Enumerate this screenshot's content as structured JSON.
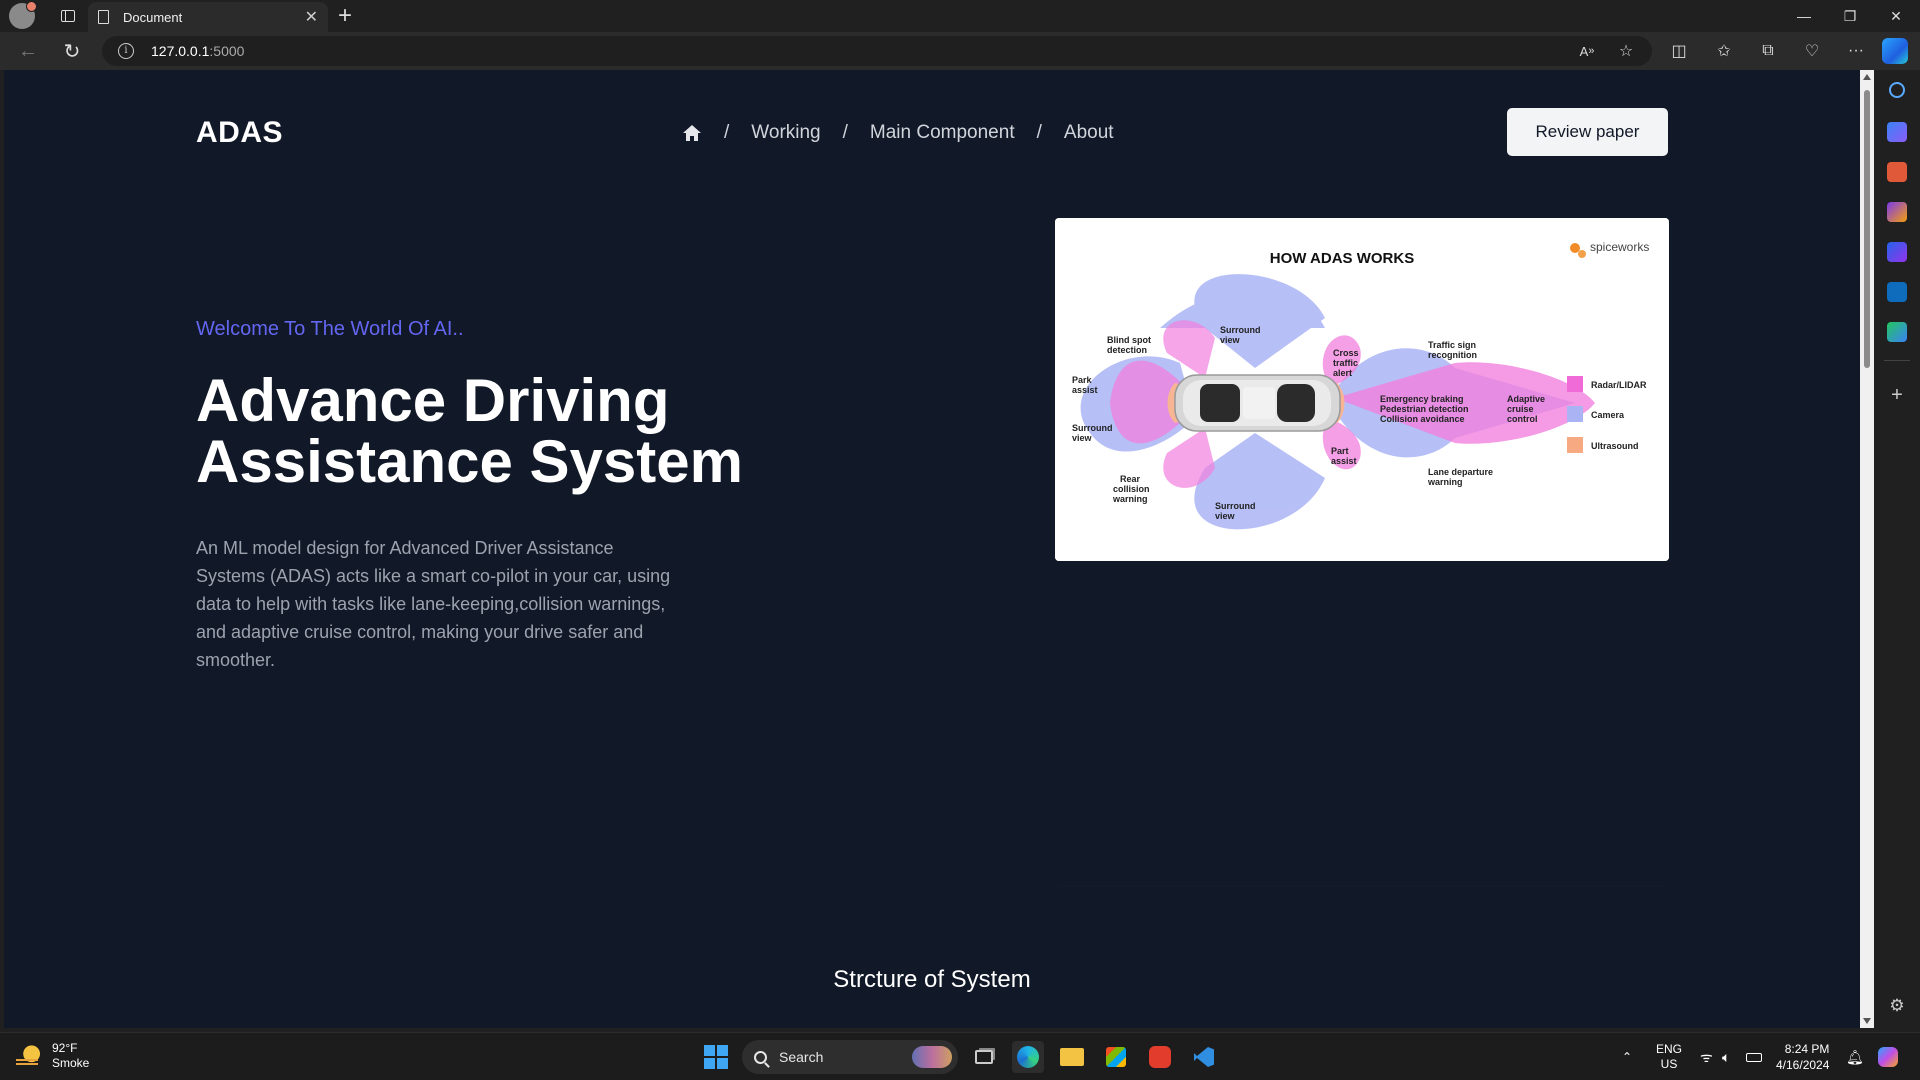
{
  "browser": {
    "tab_title": "Document",
    "url_host": "127.0.0.1",
    "url_port": ":5000"
  },
  "page": {
    "logo": "ADAS",
    "nav": [
      "Working",
      "Main Component",
      "About"
    ],
    "nav_sep": "/",
    "review_button": "Review paper",
    "welcome": "Welcome To The World Of AI..",
    "headline": "Advance Driving Assistance System",
    "description": "An ML model design for Advanced Driver Assistance Systems (ADAS) acts like a smart co-pilot in your car, using data to help with tasks like lane-keeping,collision warnings, and adaptive cruise control, making your drive safer and smoother.",
    "section_title": "Strcture of System"
  },
  "figure": {
    "title": "HOW ADAS WORKS",
    "brand": "spiceworks",
    "labels": {
      "blind_spot": [
        "Blind spot",
        "detection"
      ],
      "surround_top": [
        "Surround",
        "view"
      ],
      "cross_traffic": [
        "Cross",
        "traffic",
        "alert"
      ],
      "traffic_sign": [
        "Traffic sign",
        "recognition"
      ],
      "park_assist": [
        "Park",
        "assist"
      ],
      "surround_left": [
        "Surround",
        "view"
      ],
      "emergency": [
        "Emergency braking",
        "Pedestrian detection",
        "Collision avoidance"
      ],
      "adaptive": [
        "Adaptive",
        "cruise",
        "control"
      ],
      "rear_collision": [
        "Rear",
        "collision",
        "warning"
      ],
      "part_assist": [
        "Part",
        "assist"
      ],
      "lane_departure": [
        "Lane departure",
        "warning"
      ],
      "surround_bottom": [
        "Surround",
        "view"
      ]
    },
    "legend": [
      {
        "label": "Radar/LIDAR",
        "color": "#f06ad8"
      },
      {
        "label": "Camera",
        "color": "#aab4f5"
      },
      {
        "label": "Ultrasound",
        "color": "#f7a982"
      }
    ]
  },
  "taskbar": {
    "weather_temp": "92°F",
    "weather_desc": "Smoke",
    "search_placeholder": "Search",
    "lang": "ENG",
    "region": "US",
    "time": "8:24 PM",
    "date": "4/16/2024"
  },
  "colors": {
    "page_bg": "#111827",
    "accent": "#6366f1",
    "desc": "#9ca3af"
  }
}
